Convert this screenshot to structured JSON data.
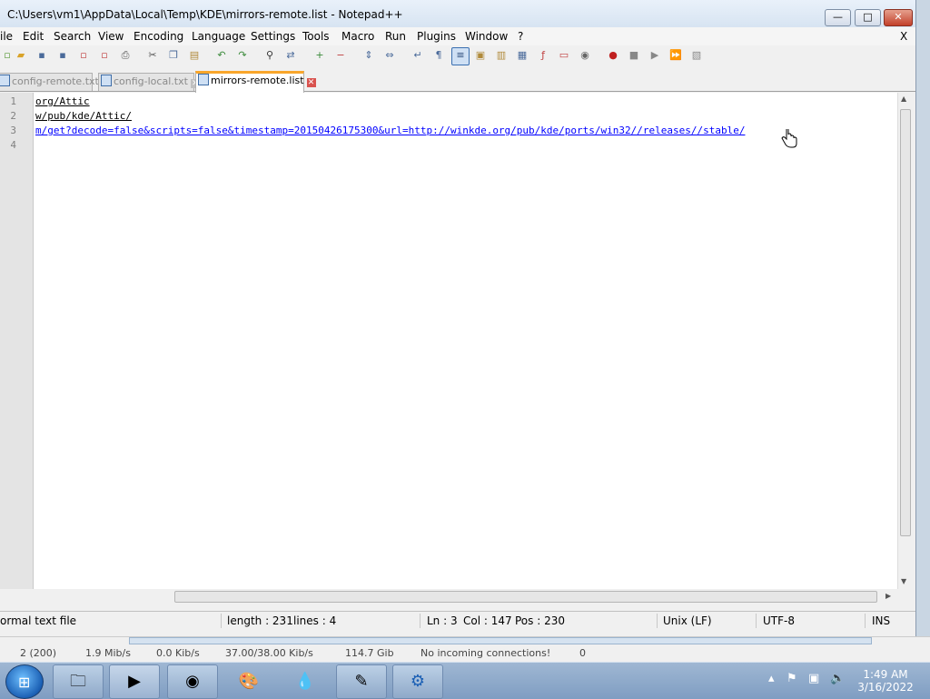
{
  "window": {
    "title": "C:\\Users\\vm1\\AppData\\Local\\Temp\\KDE\\mirrors-remote.list - Notepad++",
    "minimize": "—",
    "maximize": "□",
    "close": "✕"
  },
  "menubar": {
    "items": [
      "ile",
      "Edit",
      "Search",
      "View",
      "Encoding",
      "Language",
      "Settings",
      "Tools",
      "Macro",
      "Run",
      "Plugins",
      "Window",
      "?"
    ],
    "close_x": "X"
  },
  "tabs": [
    {
      "label": "config-remote.txt",
      "active": false
    },
    {
      "label": "config-local.txt",
      "active": false
    },
    {
      "label": "mirrors-remote.list",
      "active": true
    }
  ],
  "editor": {
    "line_numbers": [
      "1",
      "2",
      "3",
      "4"
    ],
    "lines": [
      "org/Attic",
      "w/pub/kde/Attic/",
      "m/get?decode=false&scripts=false&timestamp=20150426175300&url=http://winkde.org/pub/kde/ports/win32//releases//stable/",
      ""
    ]
  },
  "statusbar": {
    "file_type": "ormal text file",
    "length": "length : 231",
    "lines": "lines : 4",
    "ln": "Ln : 3",
    "col": "Col : 147",
    "pos": "Pos : 230",
    "eol": "Unix (LF)",
    "encoding": "UTF-8",
    "mode": "INS"
  },
  "background_app": {
    "items": [
      "2 (200)",
      "1.9 Mib/s",
      "0.0 Kib/s",
      "37.00/38.00 Kib/s",
      "114.7 Gib",
      "No incoming connections!",
      "0"
    ]
  },
  "taskbar": {
    "time": "1:49 AM",
    "date": "3/16/2022",
    "apps": [
      "explorer-icon",
      "media-player-icon",
      "chrome-icon",
      "paint-icon",
      "kde-drop-icon",
      "text-editor-icon",
      "kde-icon"
    ]
  },
  "colors": {
    "link": "#0000ff",
    "active_tab_accent": "#f9a62b",
    "close_button": "#c2402a"
  }
}
